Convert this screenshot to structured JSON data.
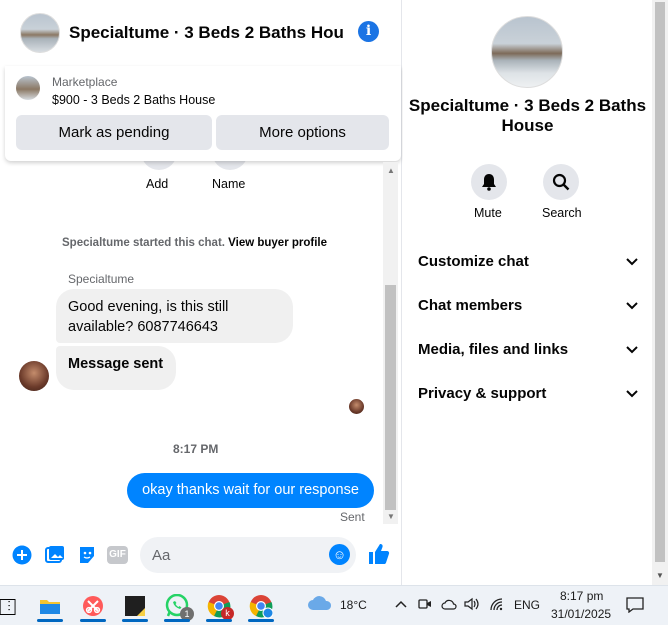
{
  "chat": {
    "title": "Specialtume · 3 Beds 2 Baths Hou···",
    "marketplace": {
      "label": "Marketplace",
      "listing": "$900 - 3 Beds 2 Baths House",
      "pending_label": "Mark as pending",
      "more_label": "More options"
    },
    "actions": {
      "add_label": "Add",
      "name_label": "Name"
    },
    "started_text": "Specialtume started this chat.",
    "view_profile_label": "View buyer profile",
    "sender_name": "Specialtume",
    "messages": [
      {
        "text": "Good evening, is this still available? 6087746643"
      },
      {
        "text": "Message sent"
      }
    ],
    "timestamp": "8:17 PM",
    "outgoing": {
      "text": "okay thanks wait for our response",
      "status": "Sent"
    },
    "composer": {
      "placeholder": "Aa",
      "gif_label": "GIF"
    }
  },
  "info": {
    "title": "Specialtume · 3 Beds 2 Baths House",
    "mute_label": "Mute",
    "search_label": "Search",
    "menu": [
      {
        "label": "Customize chat"
      },
      {
        "label": "Chat members"
      },
      {
        "label": "Media, files and links"
      },
      {
        "label": "Privacy & support"
      }
    ]
  },
  "taskbar": {
    "weather": "18°C",
    "language": "ENG",
    "time": "8:17 pm",
    "date": "31/01/2025",
    "whatsapp_badge": "1",
    "chrome_badge": "k"
  }
}
